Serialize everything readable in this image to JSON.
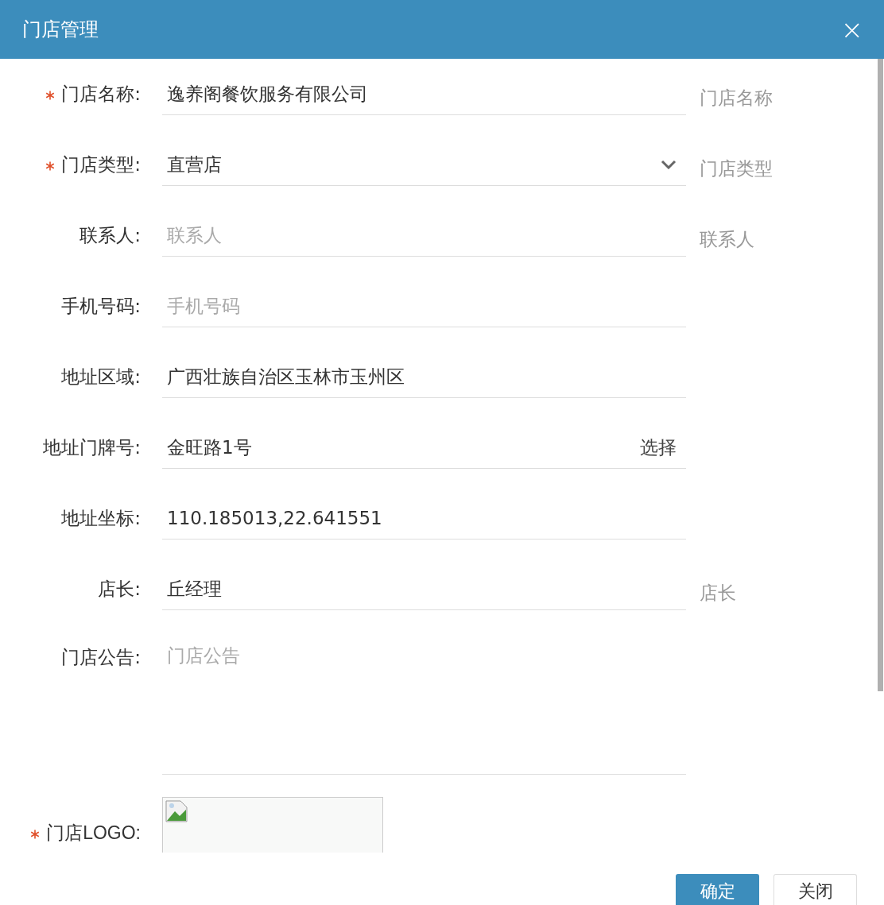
{
  "dialog": {
    "title": "门店管理",
    "close": "×"
  },
  "fields": [
    {
      "kind": "text",
      "label": "门店名称:",
      "required": true,
      "value": "逸养阁餐饮服务有限公司",
      "hint": "门店名称"
    },
    {
      "kind": "select",
      "label": "门店类型:",
      "required": true,
      "value": "直营店",
      "hint": "门店类型"
    },
    {
      "kind": "text",
      "label": "联系人:",
      "required": false,
      "placeholder": "联系人",
      "hint": "联系人"
    },
    {
      "kind": "text",
      "label": "手机号码:",
      "required": false,
      "placeholder": "手机号码"
    },
    {
      "kind": "text",
      "label": "地址区域:",
      "required": false,
      "value": "广西壮族自治区玉林市玉州区"
    },
    {
      "kind": "picker",
      "label": "地址门牌号:",
      "required": false,
      "value": "金旺路1号",
      "action": "选择"
    },
    {
      "kind": "text",
      "label": "地址坐标:",
      "required": false,
      "value": "110.185013,22.641551"
    },
    {
      "kind": "text",
      "label": "店长:",
      "required": false,
      "value": "丘经理",
      "hint": "店长"
    },
    {
      "kind": "textarea",
      "label": "门店公告:",
      "required": false,
      "placeholder": "门店公告"
    },
    {
      "kind": "image",
      "label": "门店LOGO:",
      "required": true
    }
  ],
  "buttons": [
    {
      "label": "确定",
      "primary": true
    },
    {
      "label": "关闭",
      "primary": false
    }
  ]
}
